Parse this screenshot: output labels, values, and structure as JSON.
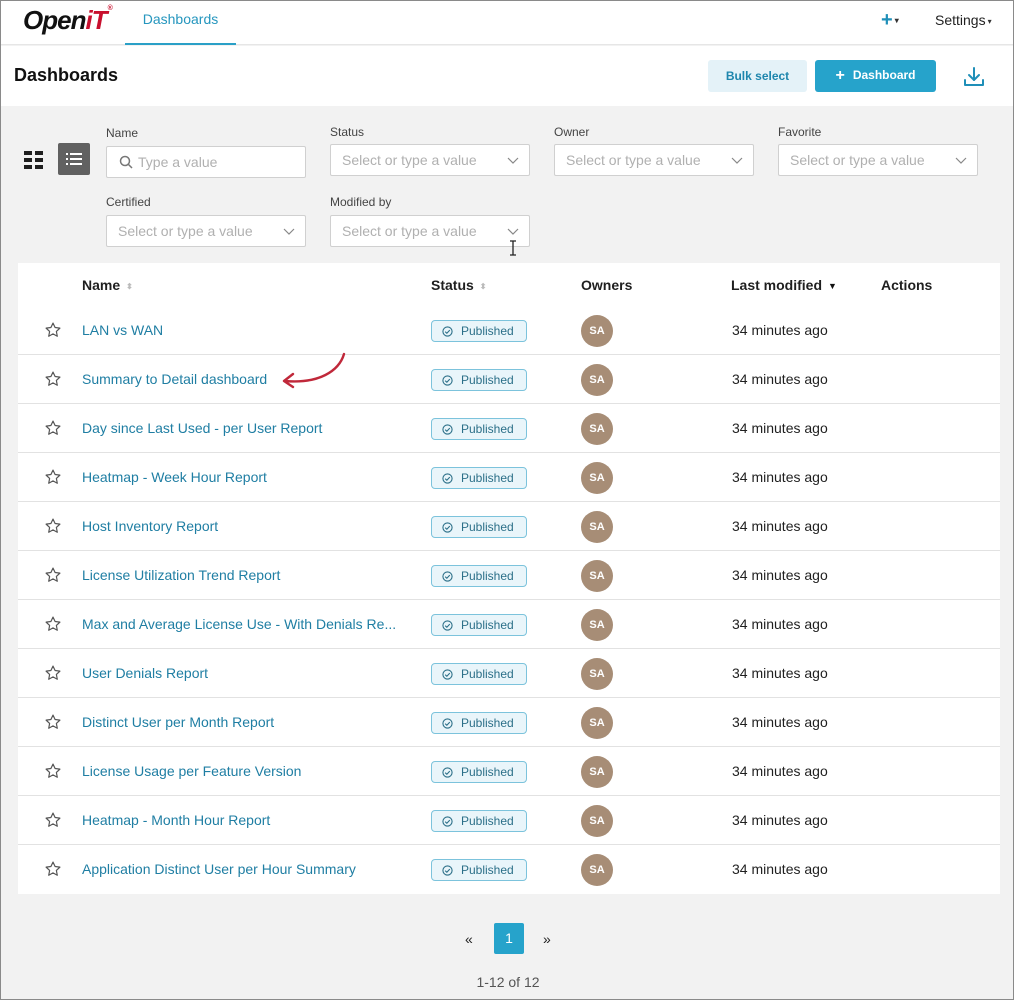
{
  "brand": {
    "logo_main": "Open",
    "logo_accent": "iT",
    "logo_mark": "®"
  },
  "topnav": {
    "active_tab": "Dashboards",
    "plus": "+",
    "settings": "Settings"
  },
  "header": {
    "title": "Dashboards",
    "bulk_select": "Bulk select",
    "add_dashboard": "Dashboard"
  },
  "filters": {
    "name": {
      "label": "Name",
      "placeholder": "Type a value"
    },
    "status": {
      "label": "Status",
      "placeholder": "Select or type a value"
    },
    "owner": {
      "label": "Owner",
      "placeholder": "Select or type a value"
    },
    "favorite": {
      "label": "Favorite",
      "placeholder": "Select or type a value"
    },
    "certified": {
      "label": "Certified",
      "placeholder": "Select or type a value"
    },
    "modified_by": {
      "label": "Modified by",
      "placeholder": "Select or type a value"
    }
  },
  "table": {
    "columns": {
      "name": "Name",
      "status": "Status",
      "owners": "Owners",
      "last_modified": "Last modified",
      "actions": "Actions"
    },
    "rows": [
      {
        "name": "LAN vs WAN",
        "status": "Published",
        "owner": "SA",
        "modified": "34 minutes ago"
      },
      {
        "name": "Summary to Detail dashboard",
        "status": "Published",
        "owner": "SA",
        "modified": "34 minutes ago"
      },
      {
        "name": "Day since Last Used - per User Report",
        "status": "Published",
        "owner": "SA",
        "modified": "34 minutes ago"
      },
      {
        "name": "Heatmap - Week Hour Report",
        "status": "Published",
        "owner": "SA",
        "modified": "34 minutes ago"
      },
      {
        "name": "Host Inventory Report",
        "status": "Published",
        "owner": "SA",
        "modified": "34 minutes ago"
      },
      {
        "name": "License Utilization Trend Report",
        "status": "Published",
        "owner": "SA",
        "modified": "34 minutes ago"
      },
      {
        "name": "Max and Average License Use - With Denials Re...",
        "status": "Published",
        "owner": "SA",
        "modified": "34 minutes ago"
      },
      {
        "name": "User Denials Report",
        "status": "Published",
        "owner": "SA",
        "modified": "34 minutes ago"
      },
      {
        "name": "Distinct User per Month Report",
        "status": "Published",
        "owner": "SA",
        "modified": "34 minutes ago"
      },
      {
        "name": "License Usage per Feature Version",
        "status": "Published",
        "owner": "SA",
        "modified": "34 minutes ago"
      },
      {
        "name": "Heatmap - Month Hour Report",
        "status": "Published",
        "owner": "SA",
        "modified": "34 minutes ago"
      },
      {
        "name": "Application Distinct User per Hour Summary",
        "status": "Published",
        "owner": "SA",
        "modified": "34 minutes ago"
      }
    ]
  },
  "pagination": {
    "prev": "«",
    "current": "1",
    "next": "»",
    "count": "1-12 of 12"
  },
  "colors": {
    "accent": "#26a3cb",
    "link": "#1f7ea3",
    "avatar": "#a78d76",
    "annotation": "#c0283a"
  }
}
